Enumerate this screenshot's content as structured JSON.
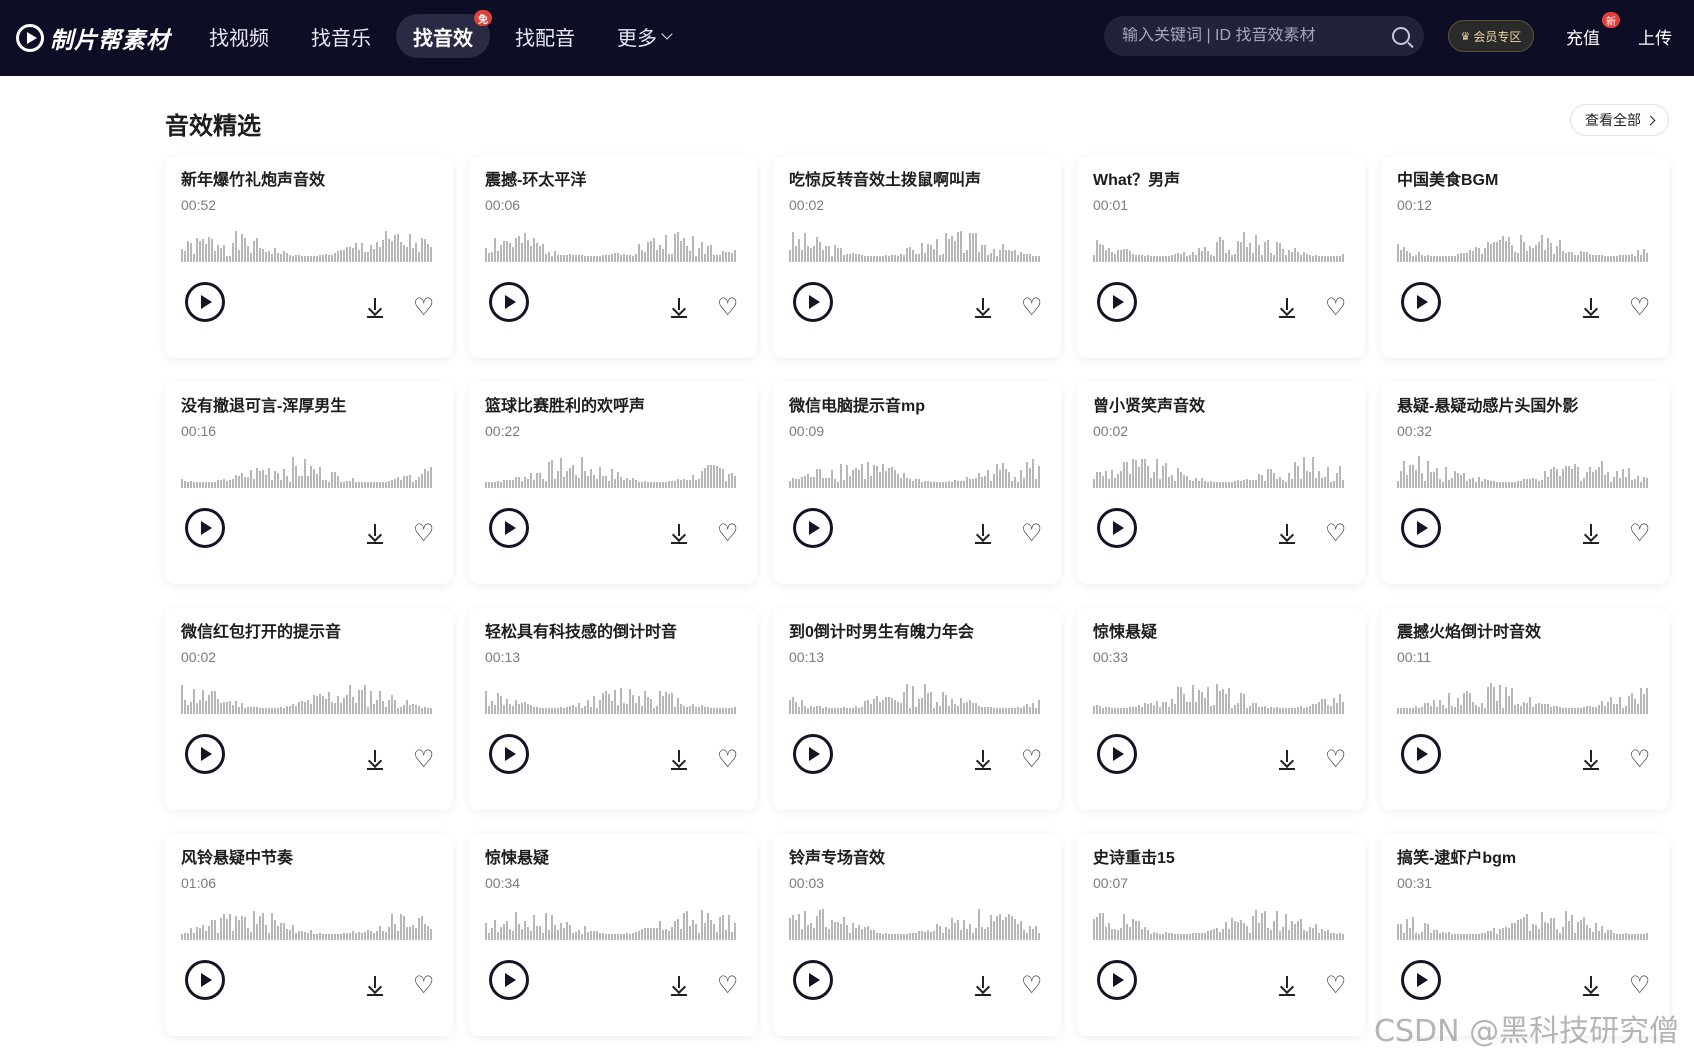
{
  "header": {
    "logo_text": "制片帮素材",
    "nav": [
      {
        "label": "找视频"
      },
      {
        "label": "找音乐"
      },
      {
        "label": "找音效",
        "badge": "免"
      },
      {
        "label": "找配音"
      },
      {
        "label": "更多"
      }
    ],
    "search_placeholder": "输入关键词 | ID 找音效素材",
    "vip_label": "会员专区",
    "recharge_label": "充值",
    "recharge_badge": "新",
    "upload_label": "上传"
  },
  "section": {
    "title": "音效精选",
    "view_all": "查看全部"
  },
  "cards": [
    {
      "title": "新年爆竹礼炮声音效",
      "duration": "00:52"
    },
    {
      "title": "震撼-环太平洋",
      "duration": "00:06"
    },
    {
      "title": "吃惊反转音效土拨鼠啊叫声",
      "duration": "00:02"
    },
    {
      "title": "What？男声",
      "duration": "00:01"
    },
    {
      "title": "中国美食BGM",
      "duration": "00:12"
    },
    {
      "title": "没有撤退可言-浑厚男生",
      "duration": "00:16"
    },
    {
      "title": "篮球比赛胜利的欢呼声",
      "duration": "00:22"
    },
    {
      "title": "微信电脑提示音mp",
      "duration": "00:09"
    },
    {
      "title": "曾小贤笑声音效",
      "duration": "00:02"
    },
    {
      "title": "悬疑-悬疑动感片头国外影",
      "duration": "00:32"
    },
    {
      "title": "微信红包打开的提示音",
      "duration": "00:02"
    },
    {
      "title": "轻松具有科技感的倒计时音",
      "duration": "00:13"
    },
    {
      "title": "到0倒计时男生有魄力年会",
      "duration": "00:13"
    },
    {
      "title": "惊悚悬疑",
      "duration": "00:33"
    },
    {
      "title": "震撼火焰倒计时音效",
      "duration": "00:11"
    },
    {
      "title": "风铃悬疑中节奏",
      "duration": "01:06"
    },
    {
      "title": "惊悚悬疑",
      "duration": "00:34"
    },
    {
      "title": "铃声专场音效",
      "duration": "00:03"
    },
    {
      "title": "史诗重击15",
      "duration": "00:07"
    },
    {
      "title": "搞笑-逮虾户bgm",
      "duration": "00:31"
    }
  ],
  "watermark": "CSDN @黑科技研究僧"
}
